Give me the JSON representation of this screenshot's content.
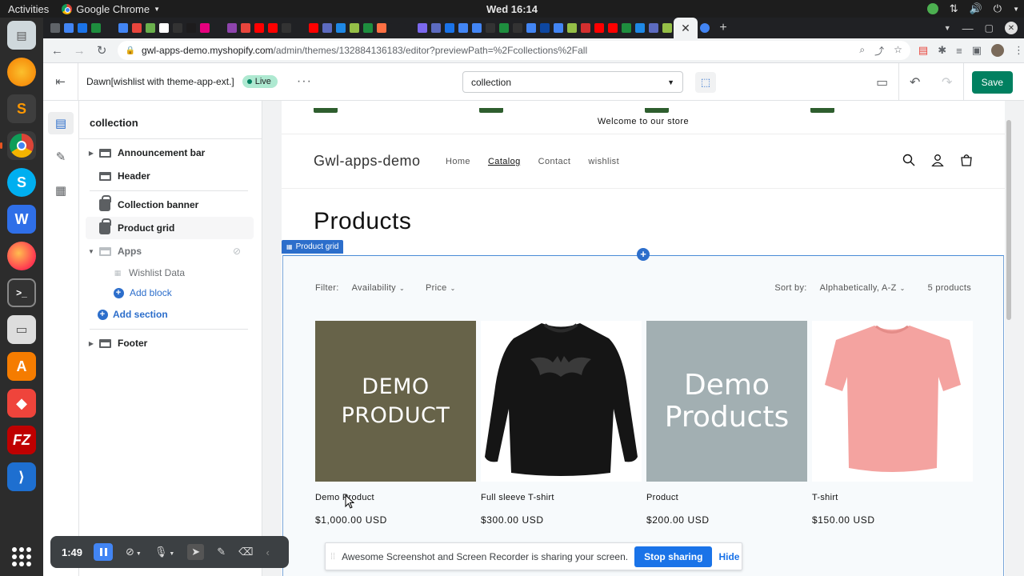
{
  "os": {
    "activities": "Activities",
    "app_name": "Google Chrome",
    "clock": "Wed 16:14"
  },
  "dock": {
    "apps": [
      "ubuntu-software-icon",
      "sublime-text-icon",
      "chrome-icon",
      "skype-icon",
      "wps-office-icon",
      "firefox-icon",
      "terminal-icon",
      "files-icon",
      "software-center-icon",
      "anydesk-icon",
      "filezilla-icon",
      "vscode-icon",
      "app-grid-icon"
    ]
  },
  "browser": {
    "url_host": "gwl-apps-demo.myshopify.com",
    "url_path": "/admin/themes/132884136183/editor?previewPath=%2Fcollections%2Fall",
    "tab_favicons": [
      "#5f6368",
      "#4285f4",
      "#1a73e8",
      "#1e8e3e",
      "#202124",
      "#4285f4",
      "#e8453c",
      "#6ab04c",
      "#ffffff",
      "#333333",
      "#1d1c1d",
      "#e6007e",
      "#202124",
      "#8e44ad",
      "#e8453c",
      "#ff0000",
      "#ff0000",
      "#333333",
      "#202124",
      "#ff0000",
      "#5c6bc0",
      "#1e88e5",
      "#95bf47",
      "#1e8e3e",
      "#ff7043",
      "#202124",
      "#202124",
      "#7b68ee",
      "#5c6bc0",
      "#1a73e8",
      "#4285f4",
      "#4285f4",
      "#333333",
      "#1e8e3e",
      "#333333",
      "#4285f4",
      "#0d47a1",
      "#4285f4",
      "#95bf47",
      "#d32f2f",
      "#ff0000",
      "#ff0000",
      "#1e8e3e",
      "#1e88e5",
      "#5c6bc0",
      "#95bf47"
    ]
  },
  "editor": {
    "theme_name": "Dawn[wishlist with theme-app-ext.]",
    "live_label": "Live",
    "template_select": "collection",
    "save_label": "Save"
  },
  "sidebar": {
    "title": "collection",
    "items": {
      "announcement_bar": "Announcement bar",
      "header": "Header",
      "collection_banner": "Collection banner",
      "product_grid": "Product grid",
      "apps": "Apps",
      "wishlist_data": "Wishlist Data",
      "add_block": "Add block",
      "add_section": "Add section",
      "footer": "Footer"
    }
  },
  "store": {
    "announcement": "Welcome to our store",
    "name": "Gwl-apps-demo",
    "nav": [
      "Home",
      "Catalog",
      "Contact",
      "wishlist"
    ],
    "nav_active": "Catalog",
    "page_title": "Products",
    "section_tag": "Product grid",
    "filter_label": "Filter:",
    "filters": [
      "Availability",
      "Price"
    ],
    "sort_label": "Sort by:",
    "sort_value": "Alphabetically, A-Z",
    "product_count": "5 products",
    "products": [
      {
        "name": "Demo Product",
        "price": "$1,000.00 USD",
        "image_text": [
          "DEMO",
          "PRODUCT"
        ]
      },
      {
        "name": "Full sleeve T-shirt",
        "price": "$300.00 USD",
        "image_text": []
      },
      {
        "name": "Product",
        "price": "$200.00 USD",
        "image_text": [
          "Demo",
          "Products"
        ]
      },
      {
        "name": "T-shirt",
        "price": "$150.00 USD",
        "image_text": []
      }
    ]
  },
  "recorder": {
    "elapsed": "1:49"
  },
  "share_banner": {
    "message": "Awesome Screenshot and Screen Recorder is sharing your screen.",
    "stop_label": "Stop sharing",
    "hide_label": "Hide"
  }
}
